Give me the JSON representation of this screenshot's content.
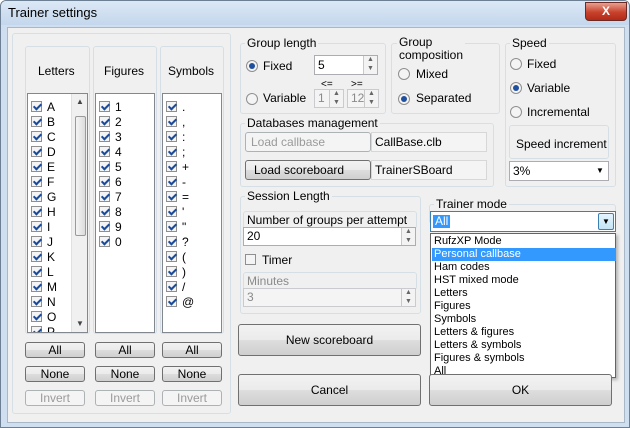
{
  "window": {
    "title": "Trainer settings",
    "close_label": "X"
  },
  "letters": {
    "header": "Letters",
    "items": [
      "A",
      "B",
      "C",
      "D",
      "E",
      "F",
      "G",
      "H",
      "I",
      "J",
      "K",
      "L",
      "M",
      "N",
      "O",
      "P"
    ]
  },
  "figures": {
    "header": "Figures",
    "items": [
      "1",
      "2",
      "3",
      "4",
      "5",
      "6",
      "7",
      "8",
      "9",
      "0"
    ]
  },
  "symbols": {
    "header": "Symbols",
    "items": [
      ".",
      ",",
      ":",
      ";",
      "+",
      "-",
      "=",
      "'",
      "\"",
      "?",
      "(",
      ")",
      "/",
      "@"
    ]
  },
  "list_buttons": {
    "all": "All",
    "none": "None",
    "invert": "Invert"
  },
  "group_length": {
    "title": "Group length",
    "fixed": "Fixed",
    "variable": "Variable",
    "fixed_value": "5",
    "le_label": "<=",
    "ge_label": ">=",
    "min_value": "1",
    "max_value": "12"
  },
  "group_composition": {
    "title_line1": "Group",
    "title_line2": "composition",
    "mixed": "Mixed",
    "separated": "Separated"
  },
  "speed": {
    "title": "Speed",
    "fixed": "Fixed",
    "variable": "Variable",
    "incremental": "Incremental",
    "increment_label": "Speed increment",
    "increment_value": "3%"
  },
  "databases": {
    "title": "Databases management",
    "load_callbase": "Load callbase",
    "callbase_file": "CallBase.clb",
    "load_scoreboard": "Load scoreboard",
    "scoreboard_file": "TrainerSBoard"
  },
  "session": {
    "title": "Session Length",
    "groups_label": "Number of groups per attempt",
    "groups_value": "20",
    "timer": "Timer",
    "minutes_label": "Minutes",
    "minutes_value": "3"
  },
  "trainer_mode": {
    "title": "Trainer mode",
    "selected": "All",
    "options": [
      "RufzXP Mode",
      "Personal callbase",
      "Ham codes",
      "HST mixed mode",
      "Letters",
      "Figures",
      "Symbols",
      "Letters & figures",
      "Letters & symbols",
      "Figures & symbols",
      "All"
    ],
    "highlighted": "Personal callbase"
  },
  "buttons": {
    "new_scoreboard": "New scoreboard",
    "cancel": "Cancel",
    "ok": "OK"
  }
}
